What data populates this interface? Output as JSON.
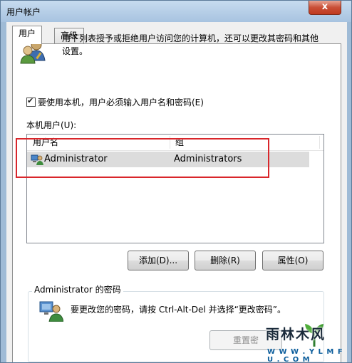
{
  "window": {
    "title": "用户帐户",
    "close_glyph": "x"
  },
  "tabs": [
    {
      "label": "用户",
      "active": true
    },
    {
      "label": "高级",
      "active": false
    }
  ],
  "description": {
    "text": "用下列表授予或拒绝用户访问您的计算机，还可以更改其密码和其他设置。"
  },
  "require_login": {
    "label": "要使用本机，用户必须输入用户名和密码(E)",
    "checked": true
  },
  "users_section": {
    "label": "本机用户(U):"
  },
  "users_table": {
    "columns": [
      "用户名",
      "组"
    ],
    "rows": [
      {
        "username": "Administrator",
        "group": "Administrators"
      }
    ]
  },
  "buttons": {
    "add": "添加(D)...",
    "remove": "删除(R)",
    "properties": "属性(O)"
  },
  "password_group": {
    "title": "Administrator 的密码",
    "text": "要更改您的密码，请按 Ctrl-Alt-Del 并选择“更改密码”。",
    "reset_button": "重置密"
  },
  "watermark": {
    "title": "雨林木风",
    "url": "W W W . Y L M F U . C O M"
  },
  "colors": {
    "highlight_border": "#d9262b",
    "selected_row": "#dcdcdc"
  }
}
